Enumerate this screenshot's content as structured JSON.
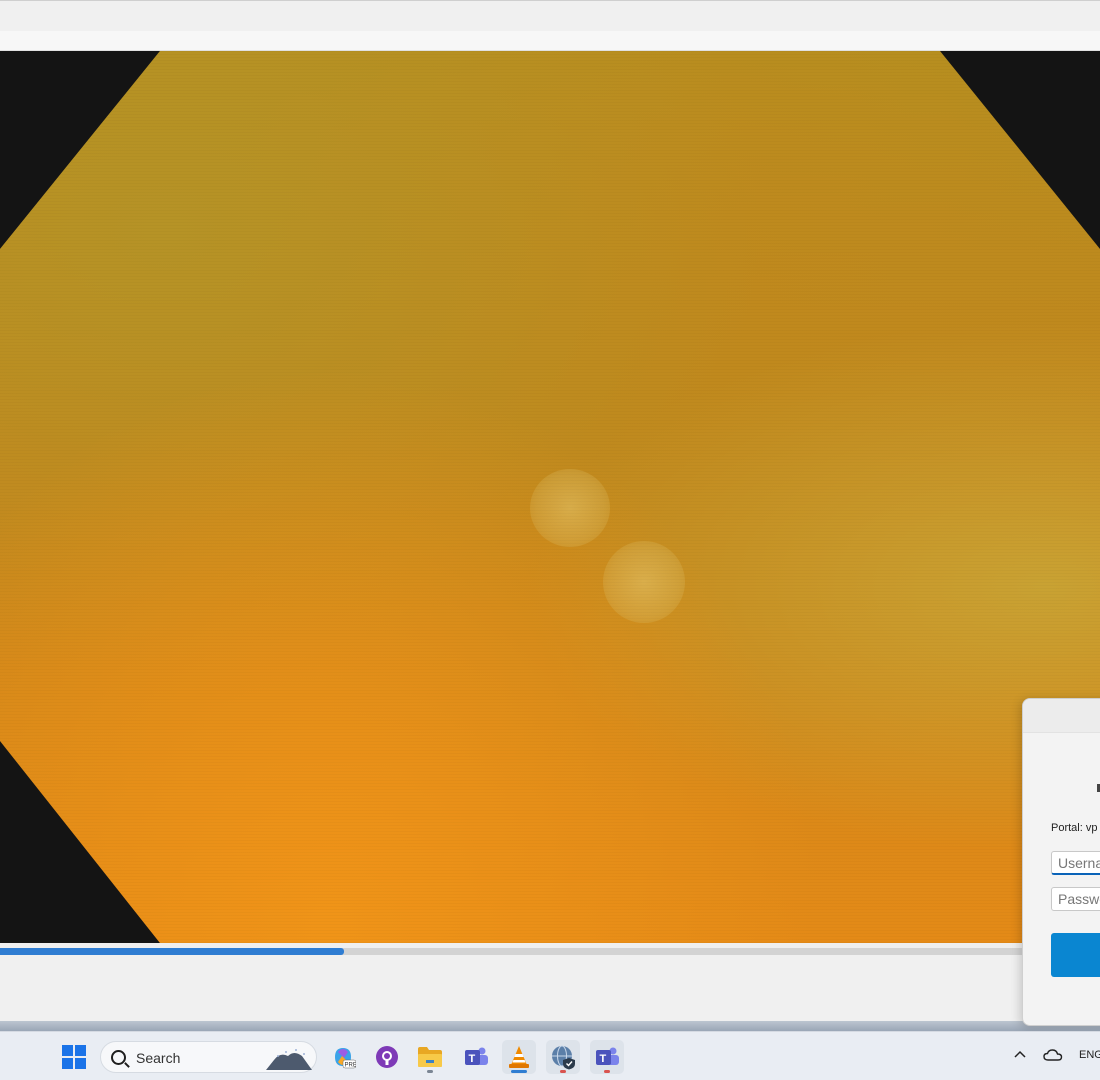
{
  "player": {
    "progress_fraction": 0.337
  },
  "dialog": {
    "portal_label": "Portal: vp",
    "username_placeholder": "Username",
    "password_placeholder": "Password"
  },
  "taskbar": {
    "search_label": "Search",
    "language": "ENG",
    "apps": [
      {
        "name": "start",
        "icon": "windows-logo-icon"
      },
      {
        "name": "copilot",
        "icon": "copilot-icon"
      },
      {
        "name": "github",
        "icon": "github-icon"
      },
      {
        "name": "file-explorer",
        "icon": "folder-icon"
      },
      {
        "name": "teams",
        "icon": "teams-icon"
      },
      {
        "name": "vlc",
        "icon": "vlc-cone-icon"
      },
      {
        "name": "vpn",
        "icon": "globe-shield-icon"
      },
      {
        "name": "teams-work",
        "icon": "teams-icon"
      }
    ]
  },
  "colors": {
    "accent": "#2f7dd2",
    "dialog_button": "#0a86d1",
    "video_orange": "#e48a17"
  }
}
